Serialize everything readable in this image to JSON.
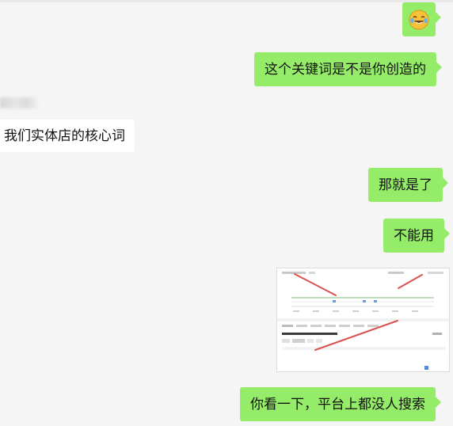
{
  "chat": {
    "messages": [
      {
        "side": "right",
        "type": "emoji",
        "icon": "laugh-cry-emoji"
      },
      {
        "side": "right",
        "type": "text",
        "text": "这个关键词是不是你创造的"
      },
      {
        "side": "left",
        "type": "text",
        "text": "我们实体店的核心词"
      },
      {
        "side": "right",
        "type": "text",
        "text": "那就是了"
      },
      {
        "side": "right",
        "type": "text",
        "text": "不能用"
      },
      {
        "side": "right",
        "type": "image",
        "description_icon": "screenshot-thumbnail"
      },
      {
        "side": "right",
        "type": "text",
        "text": "你看一下，平台上都没人搜索"
      }
    ]
  },
  "colors": {
    "background": "#f5f5f5",
    "outgoing_bubble": "#95ec69",
    "incoming_bubble": "#ffffff",
    "annotation_line": "#d9534f"
  }
}
